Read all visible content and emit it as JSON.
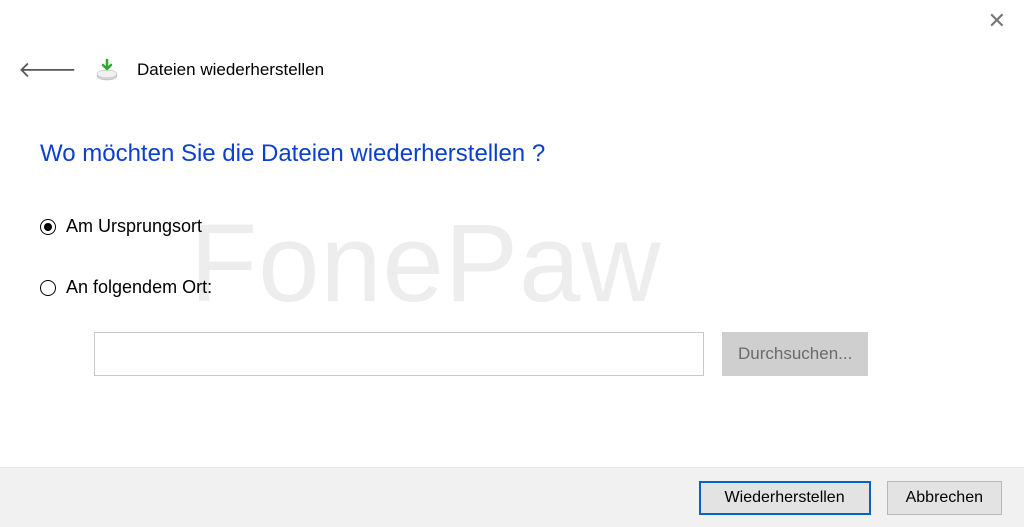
{
  "window": {
    "title": "Dateien wiederherstellen"
  },
  "heading": "Wo möchten Sie die Dateien wiederherstellen ?",
  "options": {
    "original": "Am Ursprungsort",
    "custom": "An folgendem Ort:"
  },
  "path": {
    "value": "",
    "browse_label": "Durchsuchen..."
  },
  "footer": {
    "restore": "Wiederherstellen",
    "cancel": "Abbrechen"
  },
  "watermark": "FonePaw"
}
